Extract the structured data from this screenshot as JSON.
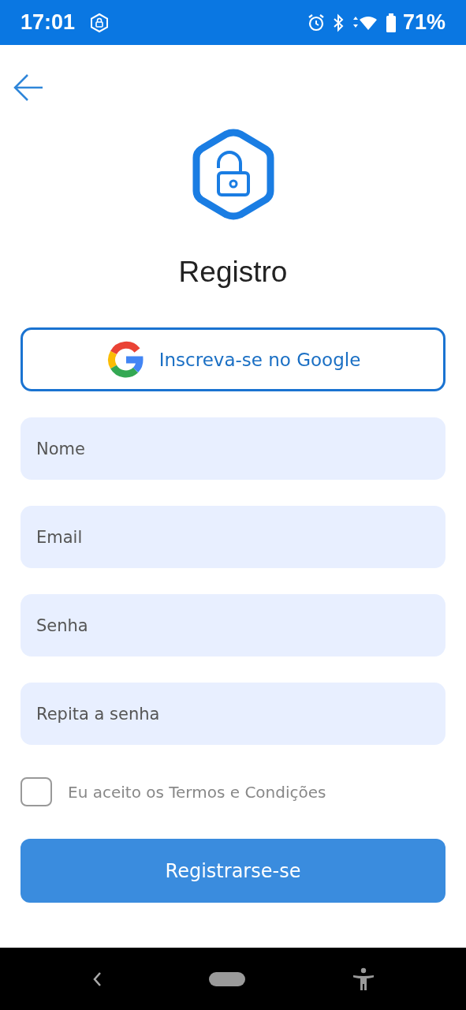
{
  "status_bar": {
    "time": "17:01",
    "battery": "71%"
  },
  "title": "Registro",
  "google_button": {
    "label": "Inscreva-se no Google"
  },
  "fields": [
    {
      "placeholder": "Nome"
    },
    {
      "placeholder": "Email"
    },
    {
      "placeholder": "Senha"
    },
    {
      "placeholder": "Repita a senha"
    }
  ],
  "terms": {
    "label": "Eu aceito os Termos e Condições",
    "checked": false
  },
  "submit_button": {
    "label": "Registrarse-se"
  }
}
